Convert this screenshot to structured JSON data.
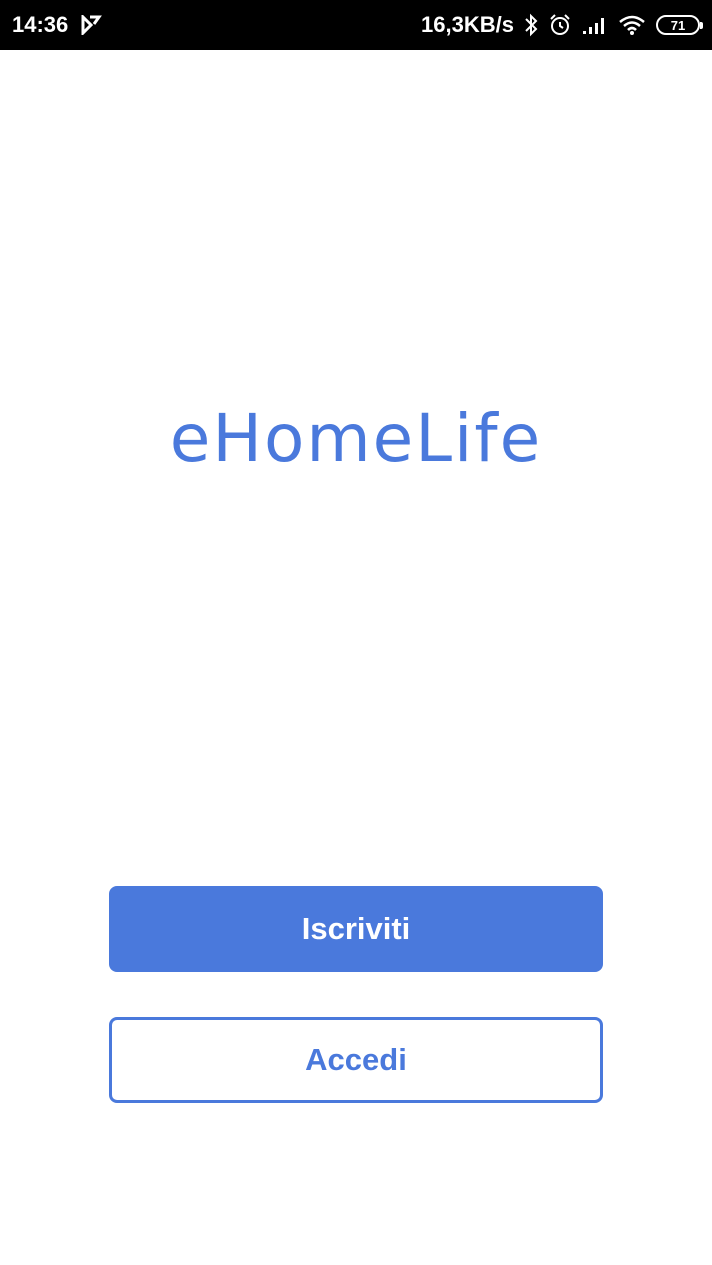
{
  "status_bar": {
    "time": "14:36",
    "network_speed": "16,3KB/s",
    "battery_level": "71",
    "icons": [
      "notification-icon",
      "bluetooth-icon",
      "alarm-icon",
      "signal-icon",
      "wifi-icon",
      "battery-icon"
    ]
  },
  "app": {
    "title": "eHomeLife"
  },
  "buttons": {
    "signup_label": "Iscriviti",
    "login_label": "Accedi"
  },
  "colors": {
    "accent": "#4a79dc",
    "background": "#ffffff",
    "status_bar": "#000000"
  }
}
